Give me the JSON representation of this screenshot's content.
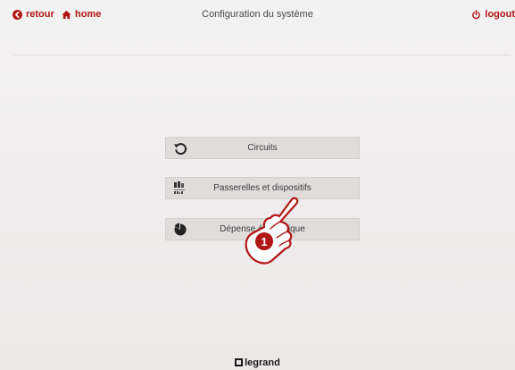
{
  "header": {
    "back_label": "retour",
    "home_label": "home",
    "title": "Configuration du système",
    "logout_label": "logout"
  },
  "menu": {
    "items": [
      {
        "label": "Circuits",
        "icon": "circular-arrow-icon"
      },
      {
        "label": "Passerelles et dispositifs",
        "icon": "device-meter-icon"
      },
      {
        "label": "Dépense énergétique",
        "icon": "pie-chart-icon"
      }
    ]
  },
  "annotation": {
    "step_number": "1",
    "icon": "pointing-hand-icon"
  },
  "footer": {
    "brand": "legrand"
  },
  "colors": {
    "accent": "#b01616",
    "button_bg": "#e0dcdc",
    "background": "#efeded"
  }
}
